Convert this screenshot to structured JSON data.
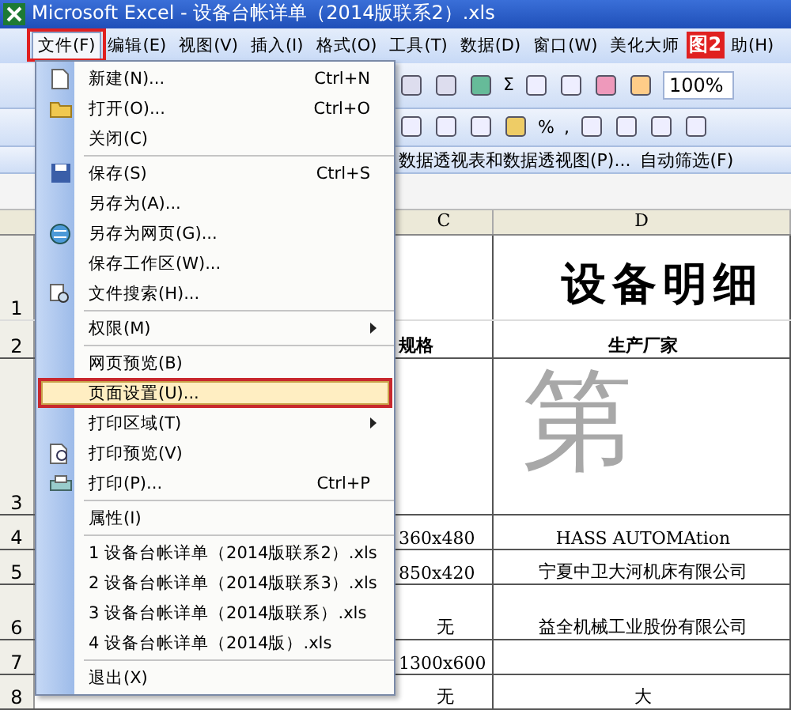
{
  "window": {
    "title": "Microsoft Excel - 设备台帐详单（2014版联系2）.xls"
  },
  "menu_bar": [
    {
      "label": "文件(F)",
      "open": true,
      "annotated": true
    },
    {
      "label": "编辑(E)",
      "open": false,
      "annotated": false
    },
    {
      "label": "视图(V)",
      "open": false,
      "annotated": false
    },
    {
      "label": "插入(I)",
      "open": false,
      "annotated": false
    },
    {
      "label": "格式(O)",
      "open": false,
      "annotated": false
    },
    {
      "label": "工具(T)",
      "open": false,
      "annotated": false
    },
    {
      "label": "数据(D)",
      "open": false,
      "annotated": false
    },
    {
      "label": "窗口(W)",
      "open": false,
      "annotated": false
    },
    {
      "label": "美化大师",
      "open": false,
      "annotated": false
    },
    {
      "label": "助(H)",
      "open": false,
      "annotated": false
    }
  ],
  "figure_label": "图2",
  "toolbar_1": {
    "sum_symbol": "Σ",
    "zoom": "100%"
  },
  "toolbar_2": {
    "percent": "%",
    "comma": ","
  },
  "toolbar_3": {
    "pivot": "数据透视表和数据透视图(P)...",
    "autofilter": "自动筛选(F)"
  },
  "sheet": {
    "columns": [
      "C",
      "D"
    ],
    "title": "设备明细",
    "page_mark": "第",
    "rows": [
      {
        "number": "1",
        "cells": [
          "",
          ""
        ]
      },
      {
        "number": "2",
        "cells": [
          "规格",
          "生产厂家"
        ]
      },
      {
        "number": "3",
        "cells": [
          "",
          ""
        ]
      },
      {
        "number": "4",
        "cells": [
          "360x480",
          "HASS  AUTOMAtion"
        ]
      },
      {
        "number": "5",
        "cells": [
          "850x420",
          "宁夏中卫大河机床有限公司"
        ]
      },
      {
        "number": "6",
        "cells": [
          "无",
          "益全机械工业股份有限公司"
        ]
      },
      {
        "number": "7",
        "cells": [
          "1300x600",
          ""
        ]
      },
      {
        "number": "8",
        "cells": [
          "无",
          "大"
        ]
      }
    ]
  },
  "file_menu": [
    {
      "kind": "item",
      "label": "新建(N)...",
      "shortcut": "Ctrl+N",
      "submenu": false,
      "highlighted": false,
      "annotated": false
    },
    {
      "kind": "item",
      "label": "打开(O)...",
      "shortcut": "Ctrl+O",
      "submenu": false,
      "highlighted": false,
      "annotated": false
    },
    {
      "kind": "item",
      "label": "关闭(C)",
      "submenu": false,
      "highlighted": false,
      "annotated": false
    },
    {
      "kind": "separator"
    },
    {
      "kind": "item",
      "label": "保存(S)",
      "shortcut": "Ctrl+S",
      "submenu": false,
      "highlighted": false,
      "annotated": false
    },
    {
      "kind": "item",
      "label": "另存为(A)...",
      "submenu": false,
      "highlighted": false,
      "annotated": false
    },
    {
      "kind": "item",
      "label": "另存为网页(G)...",
      "submenu": false,
      "highlighted": false,
      "annotated": false
    },
    {
      "kind": "item",
      "label": "保存工作区(W)...",
      "submenu": false,
      "highlighted": false,
      "annotated": false
    },
    {
      "kind": "item",
      "label": "文件搜索(H)...",
      "submenu": false,
      "highlighted": false,
      "annotated": false
    },
    {
      "kind": "separator"
    },
    {
      "kind": "item",
      "label": "权限(M)",
      "submenu": true,
      "highlighted": false,
      "annotated": false
    },
    {
      "kind": "separator"
    },
    {
      "kind": "item",
      "label": "网页预览(B)",
      "submenu": false,
      "highlighted": false,
      "annotated": false
    },
    {
      "kind": "item",
      "label": "页面设置(U)...",
      "submenu": false,
      "highlighted": true,
      "annotated": true
    },
    {
      "kind": "item",
      "label": "打印区域(T)",
      "submenu": true,
      "highlighted": false,
      "annotated": false
    },
    {
      "kind": "item",
      "label": "打印预览(V)",
      "submenu": false,
      "highlighted": false,
      "annotated": false
    },
    {
      "kind": "item",
      "label": "打印(P)...",
      "shortcut": "Ctrl+P",
      "submenu": false,
      "highlighted": false,
      "annotated": false
    },
    {
      "kind": "separator"
    },
    {
      "kind": "item",
      "label": "属性(I)",
      "submenu": false,
      "highlighted": false,
      "annotated": false
    },
    {
      "kind": "separator"
    },
    {
      "kind": "item",
      "label": "1 设备台帐详单（2014版联系2）.xls",
      "submenu": false,
      "highlighted": false,
      "annotated": false
    },
    {
      "kind": "item",
      "label": "2 设备台帐详单（2014版联系3）.xls",
      "submenu": false,
      "highlighted": false,
      "annotated": false
    },
    {
      "kind": "item",
      "label": "3 设备台帐详单（2014版联系）.xls",
      "submenu": false,
      "highlighted": false,
      "annotated": false
    },
    {
      "kind": "item",
      "label": "4 设备台帐详单（2014版）.xls",
      "submenu": false,
      "highlighted": false,
      "annotated": false
    },
    {
      "kind": "separator"
    },
    {
      "kind": "item",
      "label": "退出(X)",
      "submenu": false,
      "highlighted": false,
      "annotated": false
    }
  ]
}
